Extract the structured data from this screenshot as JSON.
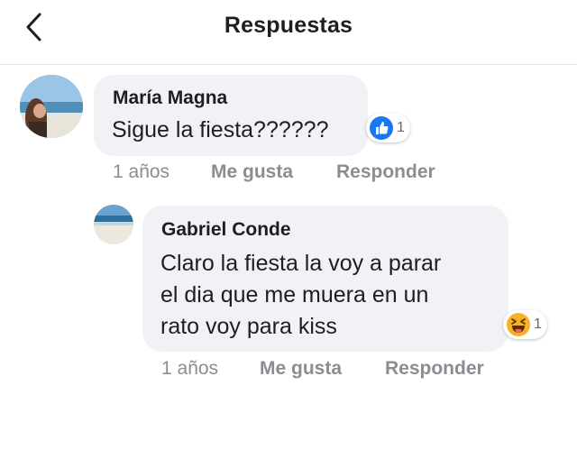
{
  "header": {
    "title": "Respuestas",
    "back_icon": "chevron-left-icon"
  },
  "comments": [
    {
      "author": "María Magna",
      "lines": [
        "Sigue la fiesta??????"
      ],
      "reaction": {
        "icon": "like-icon",
        "count": "1"
      },
      "time": "1 años",
      "like_label": "Me gusta",
      "reply_label": "Responder"
    },
    {
      "author": "Gabriel Conde",
      "lines": [
        "Claro la fiesta la voy a parar",
        "el dia que me muera en un",
        "rato voy para kiss"
      ],
      "reaction": {
        "icon": "laugh-icon",
        "count": "1"
      },
      "time": "1 años",
      "like_label": "Me gusta",
      "reply_label": "Responder"
    }
  ],
  "colors": {
    "like_blue": "#1877f2",
    "haha_yellow": "#f7b125",
    "meta_gray": "#8a8d91",
    "bubble_gray": "#f0f2f5"
  }
}
